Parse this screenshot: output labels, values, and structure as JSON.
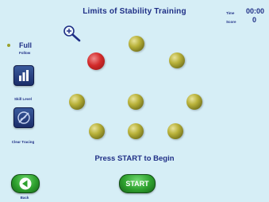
{
  "header": {
    "title": "Limits of Stability Training",
    "time_label": "Time",
    "time_value": "00:00",
    "score_label": "Score",
    "score_value": "0"
  },
  "sidebar": {
    "mode_label": "Full",
    "mode_sublabel": "Follow",
    "skill_level_label": "Skill Level",
    "clear_tracing_label": "Clear Tracing"
  },
  "main": {
    "prompt": "Press START to Begin",
    "start_label": "START",
    "back_label": "Back"
  },
  "colors": {
    "text": "#1f2f86",
    "background": "#d6eef6",
    "target_ball": "#b9b23a",
    "cursor_ball": "#d22a2a",
    "button_green": "#2ea12e"
  }
}
